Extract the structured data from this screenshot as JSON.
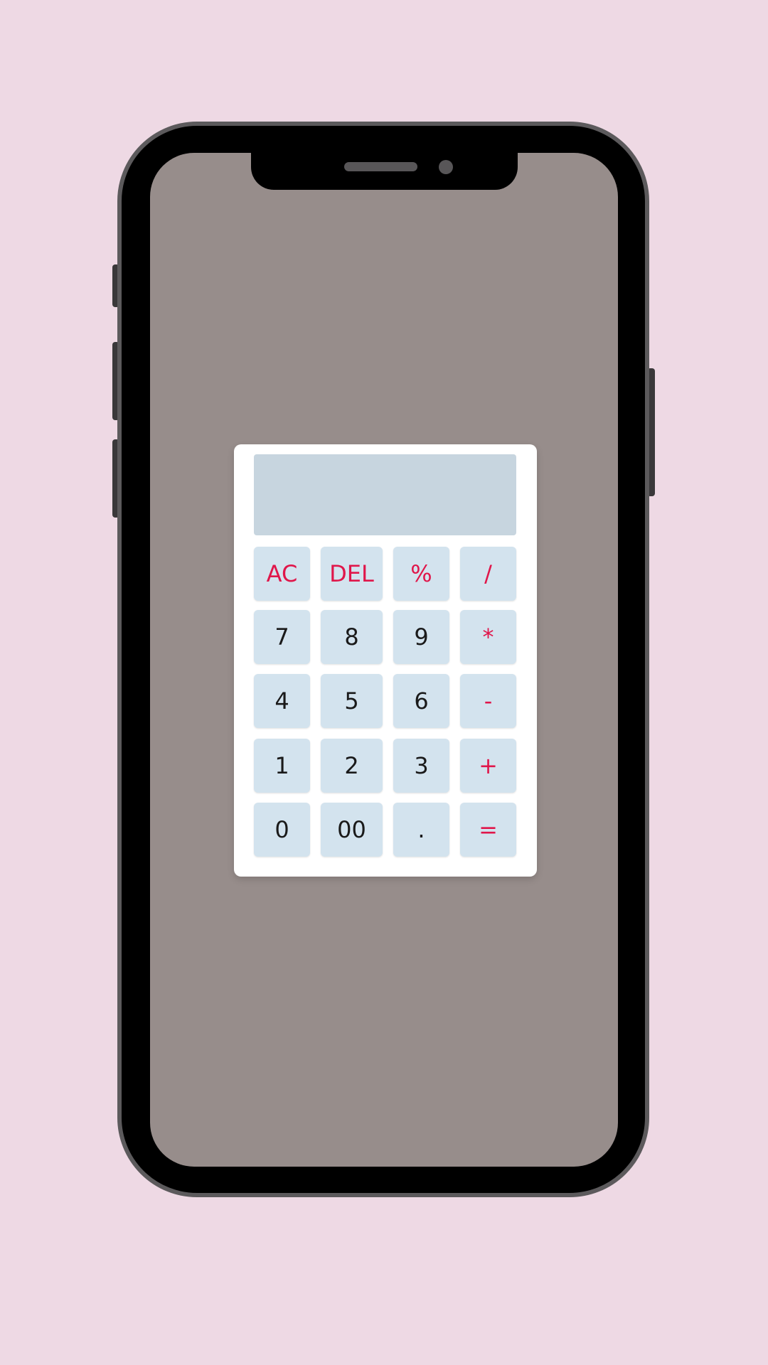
{
  "calculator": {
    "display_value": "",
    "keys": {
      "ac": "AC",
      "del": "DEL",
      "percent": "%",
      "divide": "/",
      "seven": "7",
      "eight": "8",
      "nine": "9",
      "multiply": "*",
      "four": "4",
      "five": "5",
      "six": "6",
      "minus": "-",
      "one": "1",
      "two": "2",
      "three": "3",
      "plus": "+",
      "zero": "0",
      "double_zero": "00",
      "dot": ".",
      "equals": "="
    }
  },
  "colors": {
    "page_background": "#eed9e4",
    "screen_background": "#978d8b",
    "display_background": "#c7d5df",
    "key_background": "#d3e3ee",
    "operator_text": "#e0164a",
    "digit_text": "#1a1a1a"
  }
}
